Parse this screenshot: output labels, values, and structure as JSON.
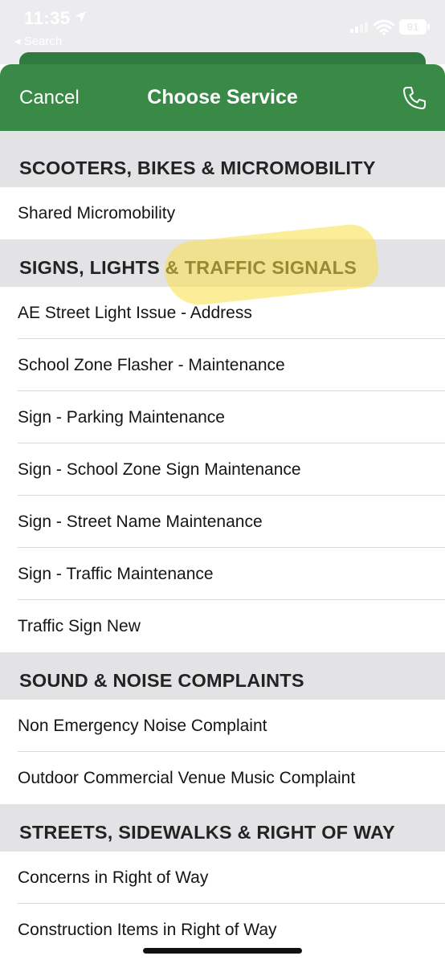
{
  "status_bar": {
    "time": "11:35",
    "back_label": "◂ Search",
    "battery": "91"
  },
  "nav": {
    "cancel_label": "Cancel",
    "title": "Choose Service"
  },
  "sections": [
    {
      "title": "SCOOTERS, BIKES & MICROMOBILITY",
      "items": [
        "Shared Micromobility"
      ]
    },
    {
      "title": "SIGNS, LIGHTS & TRAFFIC SIGNALS",
      "items": [
        "AE Street Light Issue - Address",
        "School Zone Flasher - Maintenance",
        "Sign - Parking Maintenance",
        "Sign - School Zone Sign Maintenance",
        "Sign - Street Name Maintenance",
        "Sign - Traffic Maintenance",
        "Traffic Sign New"
      ]
    },
    {
      "title": "SOUND & NOISE COMPLAINTS",
      "items": [
        "Non Emergency Noise Complaint",
        "Outdoor Commercial Venue Music Complaint"
      ]
    },
    {
      "title": "STREETS, SIDEWALKS & RIGHT OF WAY",
      "items": [
        "Concerns in Right of Way",
        "Construction Items in Right of Way"
      ]
    }
  ],
  "colors": {
    "nav_green": "#3a8a47",
    "section_bg": "#e3e3e5",
    "highlight": "#fae046"
  }
}
